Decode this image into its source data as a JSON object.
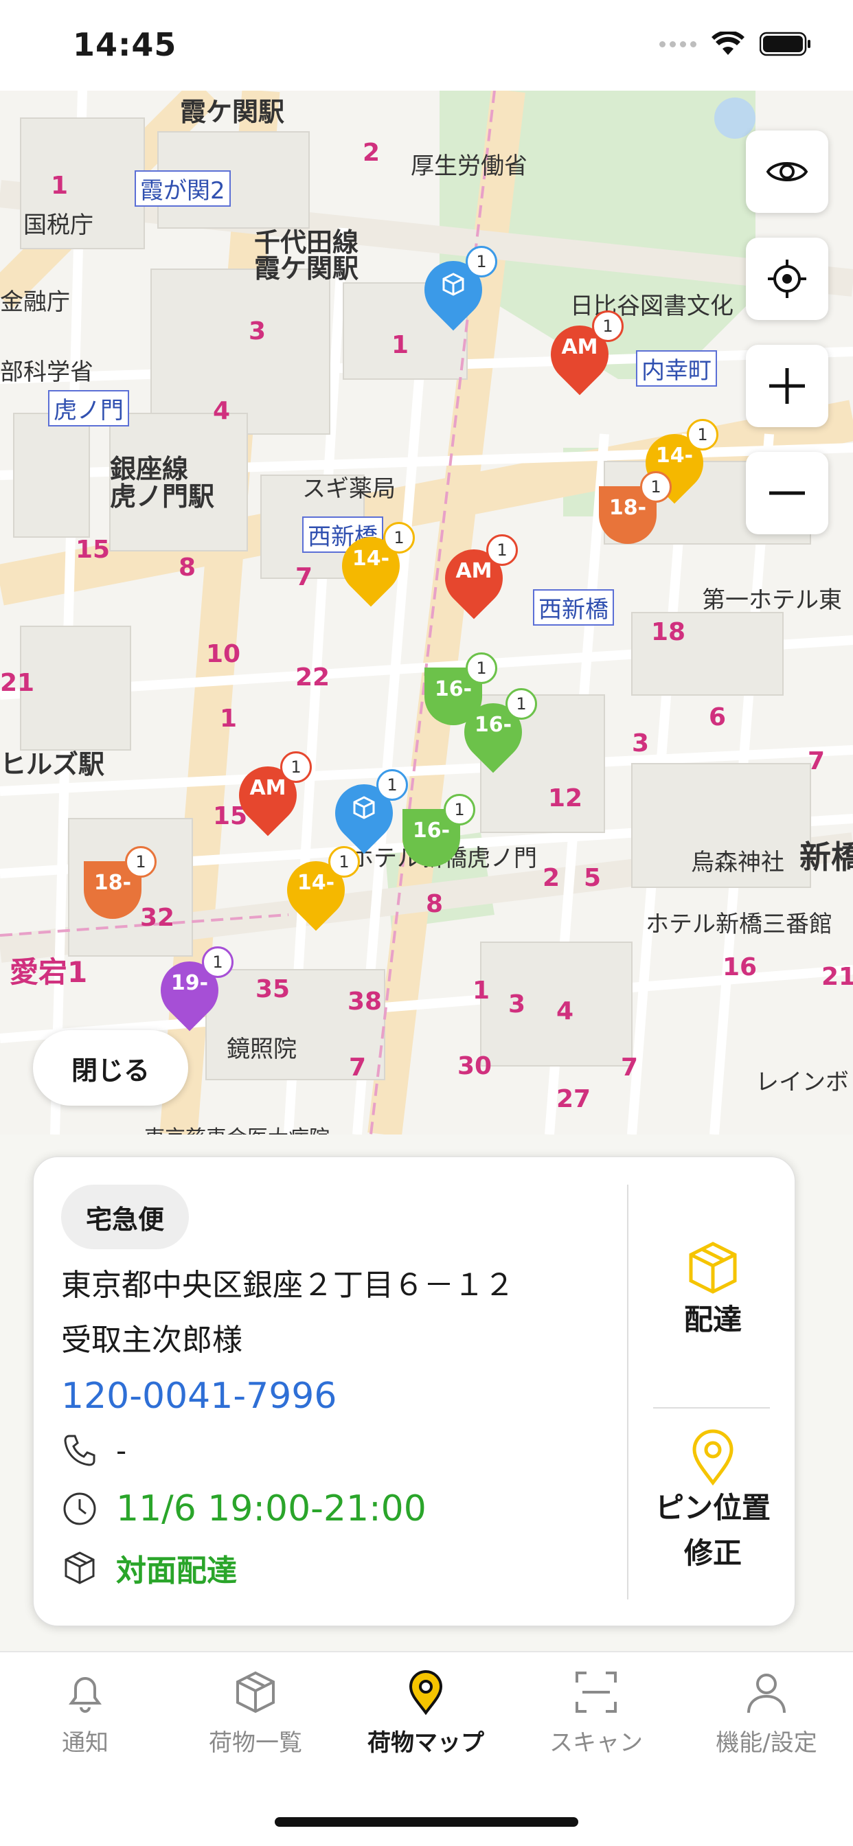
{
  "status_bar": {
    "time": "14:45"
  },
  "map": {
    "labels": {
      "kasumigaseki_sta": "霞ケ関駅",
      "kasumigaseki2": "霞が関2",
      "mhlw": "厚生労働省",
      "chiyoda_line": "千代田線",
      "kasumigaseki_sta2": "霞ケ関駅",
      "kokuzeicho": "国税庁",
      "hibiya_lib": "日比谷図書文化",
      "uchisaiwai": "内幸町",
      "toranomon": "虎ノ門",
      "ginza_line": "銀座線",
      "toranomon_sta": "虎ノ門駅",
      "sugi": "スギ薬局",
      "nishi_shinbashi": "西新橋",
      "nishi_shinbashi2": "西新橋",
      "daiichi_hotel": "第一ホテル東",
      "hills_sta": "ヒルズ駅",
      "karasumori": "烏森神社",
      "shinbashi": "新橋",
      "hotel_toranomon": "ホテル新橋虎ノ門",
      "hotel_shinbashi": "ホテル新橋三番館",
      "atago": "愛宕1",
      "kyoshoin": "鏡照院",
      "jikei": "東京慈恵会医大病院",
      "kinyucho": "金融庁",
      "monkasho": "部科学省",
      "reiwa": "レインボ",
      "n1": "1",
      "n2": "2",
      "n3": "3",
      "n4": "4",
      "n15": "15",
      "n8": "8",
      "n10": "10",
      "n22": "22",
      "n21": "21",
      "n18": "18",
      "n6": "6",
      "n12": "12",
      "n7": "7",
      "n5": "5",
      "n32": "32",
      "n35": "35",
      "n38": "38",
      "n30": "30",
      "n27": "27",
      "n16": "16",
      "n3b": "3"
    },
    "pins": [
      {
        "label": "",
        "icon": "package-icon",
        "badge": "1",
        "color": "#3b9ae8"
      },
      {
        "label": "AM",
        "badge": "1",
        "color": "#e6472e"
      },
      {
        "label": "14-",
        "badge": "1",
        "color": "#f5b800"
      },
      {
        "label": "18-",
        "badge": "1",
        "color": "#e8743a"
      },
      {
        "label": "14-",
        "badge": "1",
        "color": "#f5b800"
      },
      {
        "label": "AM",
        "badge": "1",
        "color": "#e6472e"
      },
      {
        "label": "16-",
        "badge": "1",
        "color": "#6cc24a"
      },
      {
        "label": "16-",
        "badge": "1",
        "color": "#6cc24a"
      },
      {
        "label": "AM",
        "badge": "1",
        "color": "#e6472e"
      },
      {
        "label": "",
        "icon": "package-icon",
        "badge": "1",
        "color": "#3b9ae8"
      },
      {
        "label": "16-",
        "badge": "1",
        "color": "#6cc24a"
      },
      {
        "label": "18-",
        "badge": "1",
        "color": "#e8743a"
      },
      {
        "label": "14-",
        "badge": "1",
        "color": "#f5b800"
      },
      {
        "label": "19-",
        "badge": "1",
        "color": "#a64fd6"
      }
    ],
    "close_label": "閉じる"
  },
  "detail": {
    "service": "宅急便",
    "address": "東京都中央区銀座２丁目６－１２",
    "recipient": "受取主次郎様",
    "tracking_number": "120-0041-7996",
    "phone": "-",
    "time_window": "11/6 19:00-21:00",
    "delivery_method": "対面配達",
    "deliver_label": "配達",
    "pin_fix_label_1": "ピン位置",
    "pin_fix_label_2": "修正"
  },
  "tabs": [
    {
      "label": "通知",
      "icon": "bell-icon"
    },
    {
      "label": "荷物一覧",
      "icon": "package-icon"
    },
    {
      "label": "荷物マップ",
      "icon": "map-pin-icon",
      "active": true
    },
    {
      "label": "スキャン",
      "icon": "scan-icon"
    },
    {
      "label": "機能/設定",
      "icon": "person-icon"
    }
  ],
  "colors": {
    "accent": "#f5c400",
    "link": "#2e6fd6",
    "success": "#2aa52a"
  }
}
